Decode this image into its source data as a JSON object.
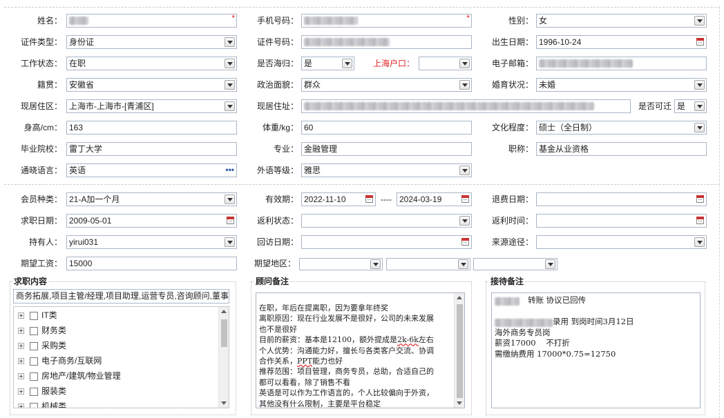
{
  "basic": {
    "name_label": "姓名：",
    "phone_label": "手机号码：",
    "gender_label": "性别：",
    "gender_value": "女",
    "id_type_label": "证件类型：",
    "id_type_value": "身份证",
    "id_number_label": "证件号码：",
    "birth_label": "出生日期：",
    "birth_value": "1996-10-24",
    "work_status_label": "工作状态：",
    "work_status_value": "在职",
    "returnee_label": "是否海归：",
    "returnee_value": "是",
    "shanghai_hukou_label": "上海户口：",
    "shanghai_hukou_value": "",
    "email_label": "电子邮箱：",
    "native_label": "籍贯：",
    "native_value": "安徽省",
    "political_label": "政治面貌：",
    "political_value": "群众",
    "marital_label": "婚育状况：",
    "marital_value": "未婚",
    "residence_label": "现居住区：",
    "residence_value": "上海市-上海市-[青浦区]",
    "address_label": "现居住址：",
    "relocate_label": "是否可迁",
    "relocate_value": "是",
    "height_label": "身高/cm：",
    "height_value": "163",
    "weight_label": "体重/kg：",
    "weight_value": "60",
    "education_label": "文化程度：",
    "education_value": "硕士（全日制）",
    "school_label": "毕业院校：",
    "school_value": "雷丁大学",
    "major_label": "专业：",
    "major_value": "金融管理",
    "title_label": "职称：",
    "title_value": "基金从业资格",
    "language_label": "通晓语言：",
    "language_value": "英语",
    "lang_level_label": "外语等级：",
    "lang_level_value": "雅思"
  },
  "membership": {
    "member_type_label": "会员种类：",
    "member_type_value": "21-A加一个月",
    "validity_label": "有效期：",
    "validity_start": "2022-11-10",
    "validity_sep": "----",
    "validity_end": "2024-03-19",
    "refund_date_label": "退费日期：",
    "refund_date_value": "",
    "job_date_label": "求职日期：",
    "job_date_value": "2009-05-01",
    "rebate_status_label": "返利状态：",
    "rebate_status_value": "",
    "rebate_time_label": "返利时间：",
    "rebate_time_value": "",
    "holder_label": "持有人：",
    "holder_value": "yirui031",
    "revisit_label": "回访日期：",
    "revisit_value": "",
    "source_label": "来源途径：",
    "source_value": "",
    "salary_label": "期望工资：",
    "salary_value": "15000",
    "region_label": "期望地区："
  },
  "job_content": {
    "legend": "求职内容",
    "summary": "商务拓展,项目主管/经理,项目助理,运营专员,咨询顾问,董事",
    "categories": [
      "IT类",
      "财务类",
      "采购类",
      "电子商务/互联网",
      "房地产/建筑/物业管理",
      "服装类",
      "机械类"
    ]
  },
  "consultant_note": {
    "legend": "顾问备注",
    "l1": "在职，年后在提离职，因为要拿年终奖",
    "l2": "离职原因：现在行业发展不是很好，公司的未来发展",
    "l3": "也不是很好",
    "l4a": "目前的薪资：基本是12100，额外提成是",
    "l4b": "2k-6k",
    "l4c": "左右",
    "l5": "个人优势：沟通能力好，擅长与各类客户交流、协调",
    "l6a": "合作关系，",
    "l6b": "PPT",
    "l6c": "能力也好",
    "l7": "推荐范围：项目管理，商务专员，总助，合适自己的",
    "l8": "都可以看看，除了销售不看",
    "l9": "英语是可以作为工作语言的，个人比较偏向于外资，",
    "l10": "其他没有什么限制，主要是平台稳定"
  },
  "reception_note": {
    "legend": "接待备注",
    "l1": "转账 协议已回传",
    "l2": "录用 到岗时间3月12日",
    "l3": "海外商务专员岗",
    "l4": "薪资17000    不打折",
    "l5": "需缴纳费用 17000*0.75=12750"
  },
  "icons": [
    "dropdown-arrow-icon",
    "calendar-icon",
    "ellipsis-icon",
    "expand-plus-icon"
  ],
  "colors": {
    "required": "#e02020",
    "border": "#a9b6c4",
    "link_blue": "#2b5fa8"
  }
}
